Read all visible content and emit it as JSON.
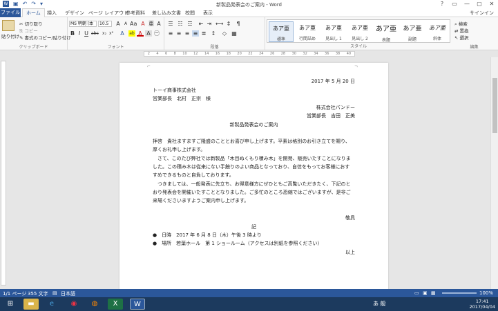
{
  "window": {
    "title": "新製品発表会のご案内 - Word",
    "controls": [
      "?",
      "▭",
      "—",
      "▢",
      "✕"
    ]
  },
  "qat": {
    "icons": [
      "word-icon",
      "save-icon",
      "undo-icon",
      "redo-icon",
      "customize-icon"
    ]
  },
  "tabs": [
    {
      "label": "ファイル"
    },
    {
      "label": "ホーム"
    },
    {
      "label": "挿入"
    },
    {
      "label": "デザイン"
    },
    {
      "label": "ページ レイアウト"
    },
    {
      "label": "参考資料"
    },
    {
      "label": "差し込み文書"
    },
    {
      "label": "校閲"
    },
    {
      "label": "表示"
    }
  ],
  "signin": "サインイン",
  "ribbon": {
    "clipboard": {
      "paste": "貼り付け",
      "cut": "切り取り",
      "copy": "コピー",
      "format_painter": "書式のコピー/貼り付け",
      "group": "クリップボード"
    },
    "font": {
      "name": "MS 明朝 (本",
      "size": "10.5",
      "group": "フォント"
    },
    "paragraph": {
      "group": "段落"
    },
    "styles": {
      "items": [
        {
          "sample": "あア亜",
          "name": "標準"
        },
        {
          "sample": "あア亜",
          "name": "行間詰め"
        },
        {
          "sample": "あア亜",
          "name": "見出し 1"
        },
        {
          "sample": "あア亜",
          "name": "見出し 2"
        },
        {
          "sample": "あア亜",
          "name": "表題"
        },
        {
          "sample": "あア亜",
          "name": "副題"
        },
        {
          "sample": "あア亜",
          "name": "斜体"
        }
      ],
      "group": "スタイル"
    },
    "editing": {
      "find": "検索",
      "replace": "置換",
      "select": "選択",
      "group": "編集"
    }
  },
  "document": {
    "lines": [
      {
        "text": "2017 年 5 月 20 日",
        "align": "right"
      },
      {
        "text": "トーイ商事株式会社",
        "align": "left"
      },
      {
        "text": "営業部長　北村　正宗　様",
        "align": "left"
      },
      {
        "text": "株式会社パンドー",
        "align": "right"
      },
      {
        "text": "営業部長　吉田　正美",
        "align": "right"
      },
      {
        "text": "新製品発表会のご案内",
        "align": "center"
      },
      {
        "text": "",
        "align": "left"
      },
      {
        "text": "拝啓　貴社ますますご隆盛のこととお喜び申し上げます。平素は格別のお引き立てを賜り、",
        "align": "left"
      },
      {
        "text": "厚くお礼申し上げます。",
        "align": "left"
      },
      {
        "text": "　さて、このたび弊社では新製品「木目ぬくもり積み木」を開発、販売いたすことになりま",
        "align": "left"
      },
      {
        "text": "した。この積み木は従来にない手触りのよい商品となっており、自信をもってお客様におす",
        "align": "left"
      },
      {
        "text": "すめできるものと自負しております。",
        "align": "left"
      },
      {
        "text": "　つきましては、一般発表に先立ち、お得意様方にぜひともご高覧いただきたく、下記のと",
        "align": "left"
      },
      {
        "text": "おり発表会を開催いたすこととなりました。ご多忙のところ恐縮ではございますが、是非ご",
        "align": "left"
      },
      {
        "text": "来場くださいますようご案内申し上げます。",
        "align": "left"
      },
      {
        "text": "",
        "align": "left"
      },
      {
        "text": "敬具",
        "align": "right"
      },
      {
        "text": "記",
        "align": "center"
      },
      {
        "text": "●　日時　2017 年 6 月 8 日（木）午後 3 時より",
        "align": "left"
      },
      {
        "text": "●　場所　若葉ホール　第 1 ショールーム（アクセスは別紙を参照ください）",
        "align": "left"
      },
      {
        "text": "以上",
        "align": "right"
      },
      {
        "text": "",
        "align": "left"
      }
    ]
  },
  "status": {
    "page": "1/1 ページ",
    "words": "355 文字",
    "lang": "日本語",
    "zoom": "100%"
  },
  "taskbar": {
    "apps": [
      "windows-icon",
      "explorer-icon",
      "ie-icon",
      "chrome-icon",
      "firefox-icon",
      "excel-icon",
      "word-icon"
    ],
    "time": "17:41",
    "date": "2017/04/04"
  }
}
